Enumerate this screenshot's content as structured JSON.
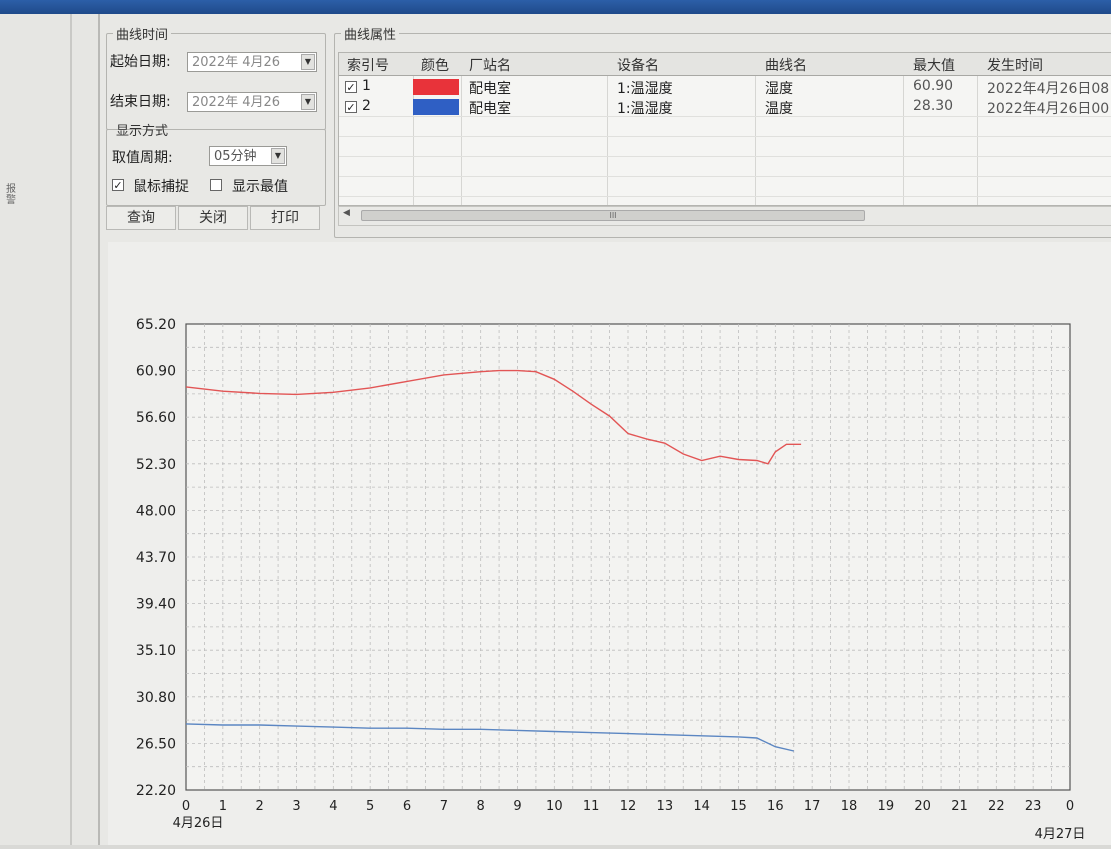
{
  "time_group": {
    "legend": "曲线时间",
    "start_label": "起始日期:",
    "start_value": "2022年 4月26",
    "end_label": "结束日期:",
    "end_value": "2022年 4月26"
  },
  "display_group": {
    "legend": "显示方式",
    "period_label": "取值周期:",
    "period_value": "05分钟",
    "mouse_capture_label": "鼠标捕捉",
    "mouse_capture_checked": true,
    "show_max_label": "显示最值",
    "show_max_checked": false
  },
  "buttons": {
    "query": "查询",
    "close": "关闭",
    "print": "打印"
  },
  "props_group": {
    "legend": "曲线属性",
    "columns": [
      "索引号",
      "颜色",
      "厂站名",
      "设备名",
      "曲线名",
      "最大值",
      "发生时间"
    ],
    "rows": [
      {
        "index": "1",
        "checked": true,
        "color": "#e8333a",
        "station": "配电室",
        "device": "1:温湿度",
        "curve": "湿度",
        "max": "60.90",
        "time": "2022年4月26日08"
      },
      {
        "index": "2",
        "checked": true,
        "color": "#2f5fc4",
        "station": "配电室",
        "device": "1:温湿度",
        "curve": "温度",
        "max": "28.30",
        "time": "2022年4月26日00"
      }
    ],
    "scroll_thumb_label": "III"
  },
  "left_panel": {
    "vertical_text": "报警"
  },
  "chart_data": {
    "type": "line",
    "ylim": [
      22.2,
      65.2
    ],
    "y_ticks": [
      "65.20",
      "60.90",
      "56.60",
      "52.30",
      "48.00",
      "43.70",
      "39.40",
      "35.10",
      "30.80",
      "26.50",
      "22.20"
    ],
    "xlim": [
      0,
      24
    ],
    "x_ticks": [
      "0",
      "1",
      "2",
      "3",
      "4",
      "5",
      "6",
      "7",
      "8",
      "9",
      "10",
      "11",
      "12",
      "13",
      "14",
      "15",
      "16",
      "17",
      "18",
      "19",
      "20",
      "21",
      "22",
      "23",
      "0"
    ],
    "x_date_start": "4月26日",
    "x_date_end": "4月27日",
    "grid": true,
    "series": [
      {
        "color": "#e25555",
        "x": [
          0,
          1,
          2,
          3,
          4,
          5,
          6,
          7,
          8,
          8.5,
          9,
          9.5,
          10,
          10.5,
          11,
          11.5,
          12,
          12.5,
          13,
          13.5,
          14,
          14.5,
          15,
          15.5,
          15.8,
          16,
          16.3,
          16.7
        ],
        "y": [
          59.4,
          59.0,
          58.8,
          58.7,
          58.9,
          59.3,
          59.9,
          60.5,
          60.8,
          60.9,
          60.9,
          60.8,
          60.1,
          59.0,
          57.8,
          56.7,
          55.1,
          54.6,
          54.2,
          53.2,
          52.6,
          53.0,
          52.7,
          52.6,
          52.3,
          53.4,
          54.1,
          54.1
        ]
      },
      {
        "color": "#5b86c2",
        "x": [
          0,
          1,
          2,
          3,
          4,
          5,
          6,
          7,
          8,
          9,
          10,
          11,
          12,
          13,
          14,
          15,
          15.5,
          16,
          16.5
        ],
        "y": [
          28.3,
          28.2,
          28.2,
          28.1,
          28.0,
          27.9,
          27.9,
          27.8,
          27.8,
          27.7,
          27.6,
          27.5,
          27.4,
          27.3,
          27.2,
          27.1,
          27.0,
          26.2,
          25.8
        ]
      }
    ]
  }
}
